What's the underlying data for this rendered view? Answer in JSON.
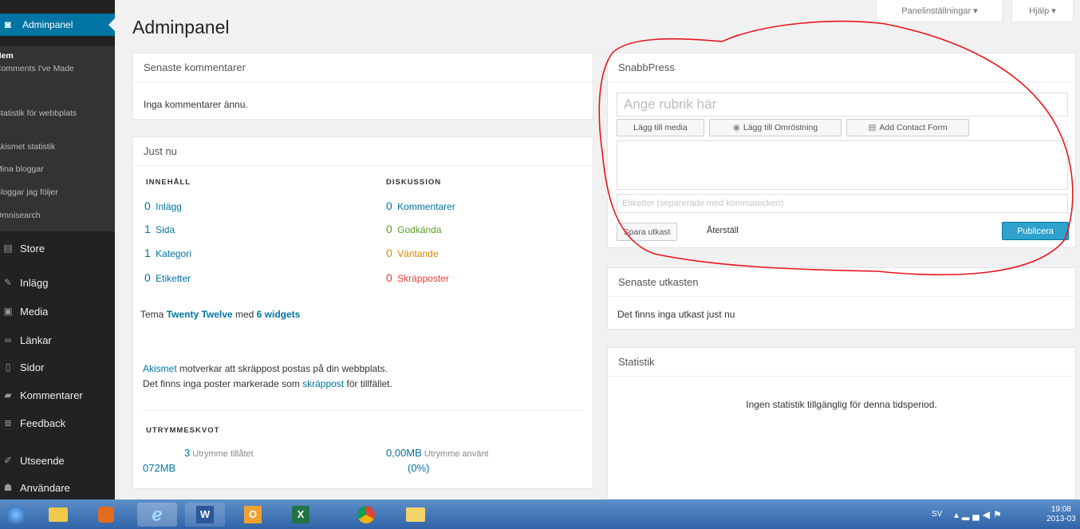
{
  "sidebar": {
    "top": "Adminpanel",
    "submenu": [
      "Hem",
      "Comments I've Made",
      "Statistik för webbplats",
      "Akismet statistik",
      "Mina bloggar",
      "Bloggar jag följer",
      "Omnisearch"
    ],
    "items": [
      "Store",
      "Inlägg",
      "Media",
      "Länkar",
      "Sidor",
      "Kommentarer",
      "Feedback",
      "Utseende",
      "Användare"
    ]
  },
  "header": {
    "title": "Adminpanel",
    "screen_options": "Panelinställningar ▾",
    "help": "Hjälp ▾"
  },
  "recent_comments": {
    "title": "Senaste kommentarer",
    "empty": "Inga kommentarer ännu."
  },
  "right_now": {
    "title": "Just nu",
    "content_head": "INNEHÅLL",
    "discussion_head": "DISKUSSION",
    "content": [
      {
        "count": "0",
        "label": "Inlägg"
      },
      {
        "count": "1",
        "label": "Sida"
      },
      {
        "count": "1",
        "label": "Kategori"
      },
      {
        "count": "0",
        "label": "Etiketter"
      }
    ],
    "discussion": [
      {
        "count": "0",
        "label": "Kommentarer"
      },
      {
        "count": "0",
        "label": "Godkända"
      },
      {
        "count": "0",
        "label": "Väntande"
      },
      {
        "count": "0",
        "label": "Skräpposter"
      }
    ],
    "theme_prefix": "Tema",
    "theme_name": "Twenty Twelve",
    "theme_mid": "med",
    "widgets": "6 widgets",
    "akismet": "Akismet",
    "akismet_text": "motverkar att skräppost postas på din webbplats.",
    "spam_line_1": "Det finns inga poster markerade som",
    "spam_link": "skräppost",
    "spam_line_2": "för tillfället.",
    "storage_head": "UTRYMMESKVOT",
    "allowed_num": "3",
    "allowed_label": "Utrymme tillåtet",
    "allowed_unit": "072MB",
    "used_num": "0,00MB",
    "used_label": "Utrymme använt",
    "used_pct": "(0%)"
  },
  "quickpress": {
    "title": "SnabbPress",
    "title_placeholder": "Ange rubrik här",
    "add_media": "Lägg till media",
    "add_poll": "Lägg till Omröstning",
    "add_contact": "Add Contact Form",
    "tags_placeholder": "Etiketter (separerade med kommatecken)",
    "save_draft": "Spara utkast",
    "reset": "Återställ",
    "publish": "Publicera"
  },
  "recent_drafts": {
    "title": "Senaste utkasten",
    "empty": "Det finns inga utkast just nu"
  },
  "stats": {
    "title": "Statistik",
    "empty": "Ingen statistik tillgänglig för denna tidsperiod."
  },
  "taskbar": {
    "lang": "SV",
    "time": "19:08",
    "date": "2013-03"
  }
}
